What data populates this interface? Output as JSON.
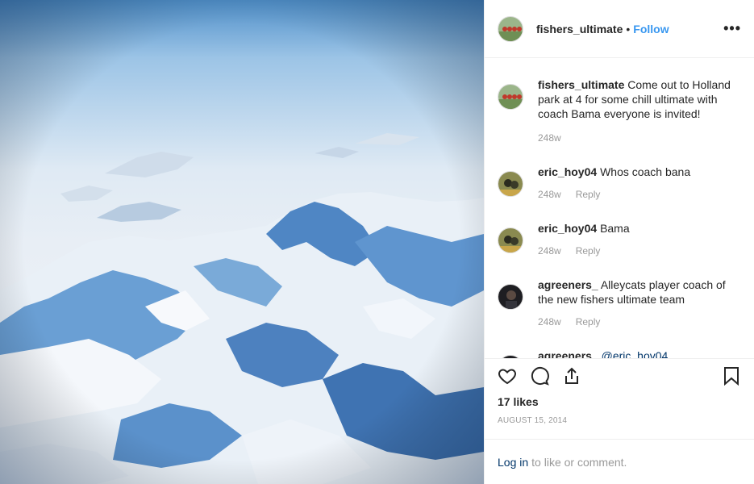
{
  "header": {
    "username": "fishers_ultimate",
    "separator": "•",
    "follow_label": "Follow",
    "more_label": "•••"
  },
  "comments": [
    {
      "username": "fishers_ultimate",
      "text": "Come out to Holland park at 4 for some chill ultimate with coach Bama everyone is invited!",
      "time": "248w",
      "reply": ""
    },
    {
      "username": "eric_hoy04",
      "text": "Whos coach bana",
      "time": "248w",
      "reply": "Reply"
    },
    {
      "username": "eric_hoy04",
      "text": "Bama",
      "time": "248w",
      "reply": "Reply"
    },
    {
      "username": "agreeners_",
      "text": "Alleycats player coach of the new fishers ultimate team",
      "time": "248w",
      "reply": "Reply"
    },
    {
      "username": "agreeners_",
      "text": "@eric_hoy04",
      "time": "",
      "reply": ""
    }
  ],
  "likes": "17 likes",
  "date": "AUGUST 15, 2014",
  "login": {
    "link": "Log in",
    "rest": "to like or comment."
  },
  "icons": [
    "heart-icon",
    "comment-icon",
    "share-icon",
    "bookmark-icon",
    "more-icon"
  ],
  "colors": {
    "accent": "#3897f0",
    "link": "#003569",
    "muted": "#999999",
    "border": "#efefef"
  }
}
